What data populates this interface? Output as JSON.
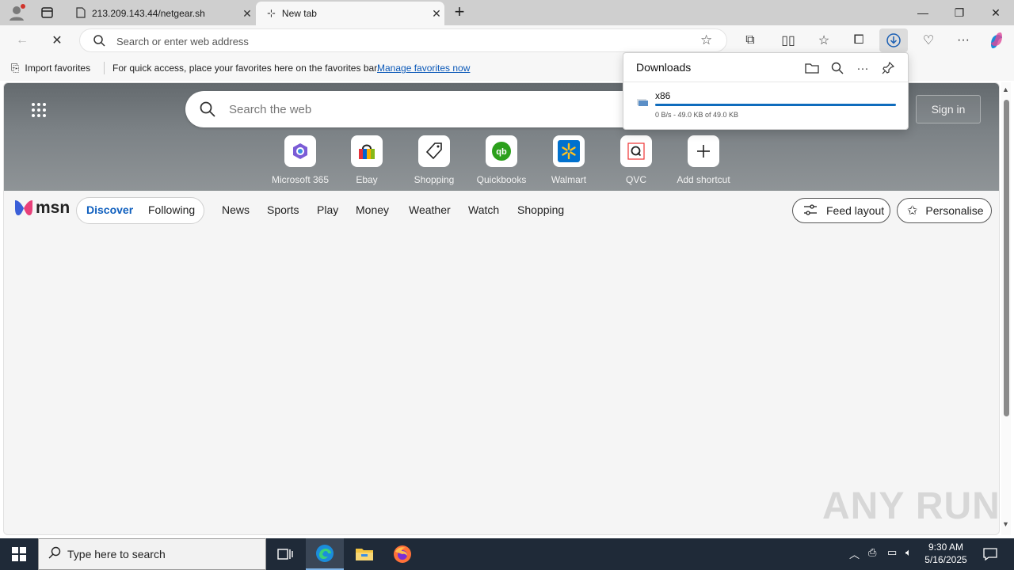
{
  "browser": {
    "tabs": [
      {
        "label": "213.209.143.44/netgear.sh",
        "active": false
      },
      {
        "label": "New tab",
        "active": true
      }
    ],
    "address_placeholder": "Search or enter web address"
  },
  "favorites_bar": {
    "import_label": "Import favorites",
    "message": "For quick access, place your favorites here on the favorites bar.",
    "manage_link": "Manage favorites now"
  },
  "downloads": {
    "title": "Downloads",
    "item": {
      "filename": "x86",
      "status": "0 B/s - 49.0 KB of 49.0 KB",
      "progress": 1.0
    }
  },
  "newtab": {
    "search_placeholder": "Search the web",
    "sign_in": "Sign in",
    "shortcuts": [
      {
        "name": "Microsoft 365",
        "icon": "microsoft-365-icon"
      },
      {
        "name": "Ebay",
        "icon": "ebay-icon"
      },
      {
        "name": "Shopping",
        "icon": "shopping-tag-icon"
      },
      {
        "name": "Quickbooks",
        "icon": "quickbooks-icon"
      },
      {
        "name": "Walmart",
        "icon": "walmart-icon"
      },
      {
        "name": "QVC",
        "icon": "qvc-icon"
      },
      {
        "name": "Add shortcut",
        "icon": "plus-icon"
      }
    ],
    "logo_text": "msn",
    "toggle": [
      "Discover",
      "Following"
    ],
    "nav": [
      "News",
      "Sports",
      "Play",
      "Money",
      "Weather",
      "Watch",
      "Shopping"
    ],
    "feed_layout": "Feed layout",
    "personalise": "Personalise"
  },
  "watermark": "ANY RUN",
  "taskbar": {
    "search_placeholder": "Type here to search",
    "time": "9:30 AM",
    "date": "5/16/2025"
  },
  "colors": {
    "accent": "#0f6cbd",
    "taskbar": "#1f2a38"
  }
}
